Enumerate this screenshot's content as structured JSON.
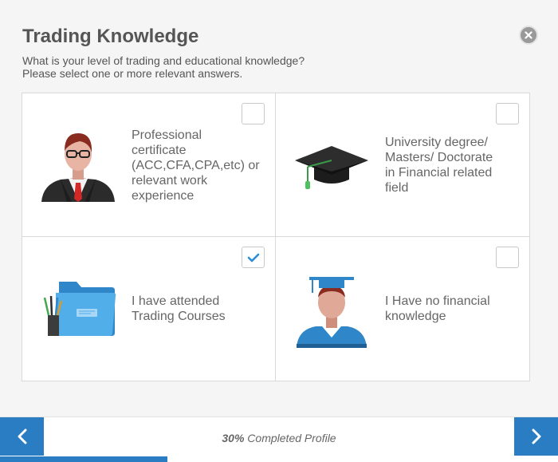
{
  "header": {
    "title": "Trading Knowledge",
    "question_line1": "What is your level of trading and educational knowledge?",
    "question_line2": "Please select one or more relevant answers.",
    "close_icon": "close-icon"
  },
  "options": [
    {
      "lines": [
        "Professional",
        "certificate",
        "(ACC,CFA,CPA,etc) or",
        "relevant work",
        "experience"
      ],
      "checked": false,
      "icon": "professional-person-icon"
    },
    {
      "lines": [
        "University degree/",
        "Masters/ Doctorate",
        "in Financial related",
        "field"
      ],
      "checked": false,
      "icon": "graduation-cap-icon"
    },
    {
      "lines": [
        "I have attended",
        "Trading Courses"
      ],
      "checked": true,
      "icon": "folder-icon"
    },
    {
      "lines": [
        "I Have no financial",
        "knowledge"
      ],
      "checked": false,
      "icon": "graduate-person-icon"
    }
  ],
  "footer": {
    "percent": "30%",
    "completed_label": " Completed Profile",
    "progress_fraction": 0.3,
    "prev_icon": "chevron-left-icon",
    "next_icon": "chevron-right-icon"
  },
  "colors": {
    "accent": "#2a7dc3",
    "check": "#2a8fd6"
  }
}
